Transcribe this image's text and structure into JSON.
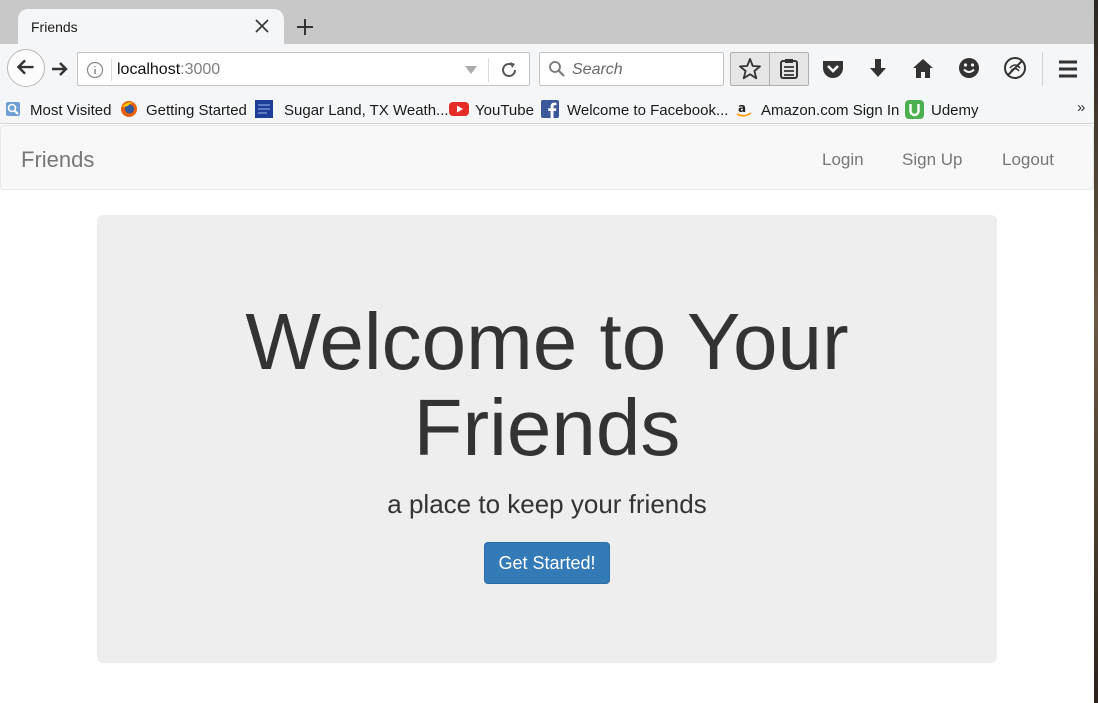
{
  "browser": {
    "tab": {
      "title": "Friends"
    },
    "url": {
      "host": "localhost",
      "port": ":3000"
    },
    "search": {
      "placeholder": "Search"
    },
    "bookmarks": [
      {
        "label": "Most Visited",
        "icon": "most-visited-icon"
      },
      {
        "label": "Getting Started",
        "icon": "firefox-icon"
      },
      {
        "label": "Sugar Land, TX Weath...",
        "icon": "weather-channel-icon"
      },
      {
        "label": "YouTube",
        "icon": "youtube-icon"
      },
      {
        "label": "Welcome to Facebook...",
        "icon": "facebook-icon"
      },
      {
        "label": "Amazon.com Sign In",
        "icon": "amazon-icon"
      },
      {
        "label": "Udemy",
        "icon": "udemy-icon"
      }
    ],
    "overflow": "»"
  },
  "site": {
    "brand": "Friends",
    "nav": {
      "login": "Login",
      "signup": "Sign Up",
      "logout": "Logout"
    },
    "hero": {
      "title_line1": "Welcome to Your",
      "title_line2": "Friends",
      "subtitle": "a place to keep your friends",
      "button": "Get Started!"
    }
  },
  "colors": {
    "primary": "#337ab7",
    "jumbotron": "#eeeeee",
    "navbar": "#f8f8f8"
  }
}
